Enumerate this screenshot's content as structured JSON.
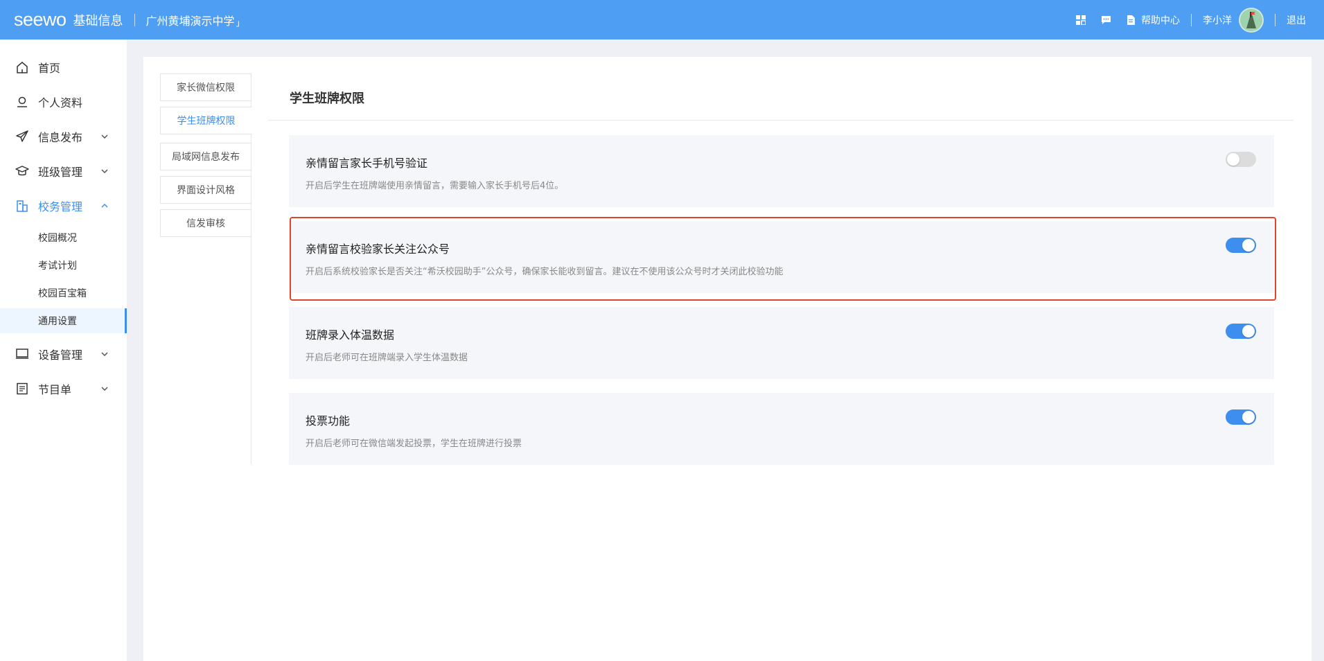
{
  "header": {
    "logo": "seewo",
    "app_title": "基础信息",
    "school": "广州黄埔演示中学",
    "school_mark": "」",
    "help_label": "帮助中心",
    "username": "李小洋",
    "logout_label": "退出",
    "icons": [
      "grid-icon",
      "message-icon",
      "document-icon"
    ]
  },
  "sidebar": {
    "items": [
      {
        "label": "首页",
        "icon": "home-icon"
      },
      {
        "label": "个人资料",
        "icon": "user-icon"
      },
      {
        "label": "信息发布",
        "icon": "send-icon"
      },
      {
        "label": "班级管理",
        "icon": "graduation-cap-icon"
      },
      {
        "label": "校务管理",
        "icon": "school-building-icon"
      },
      {
        "label": "设备管理",
        "icon": "laptop-icon"
      },
      {
        "label": "节目单",
        "icon": "list-doc-icon"
      }
    ],
    "sub_items": [
      "校园概况",
      "考试计划",
      "校园百宝箱",
      "通用设置"
    ],
    "selected_sub": "通用设置"
  },
  "tabs": [
    "家长微信权限",
    "学生班牌权限",
    "局域网信息发布",
    "界面设计风格",
    "信发审核"
  ],
  "active_tab": "学生班牌权限",
  "main": {
    "title": "学生班牌权限",
    "settings": [
      {
        "name": "亲情留言家长手机号验证",
        "desc": "开启后学生在班牌端使用亲情留言，需要输入家长手机号后4位。",
        "enabled": false
      },
      {
        "name": "亲情留言校验家长关注公众号",
        "desc": "开启后系统校验家长是否关注“希沃校园助手”公众号，确保家长能收到留言。建议在不使用该公众号时才关闭此校验功能",
        "enabled": true
      },
      {
        "name": "班牌录入体温数据",
        "desc": "开启后老师可在班牌端录入学生体温数据",
        "enabled": true
      },
      {
        "name": "投票功能",
        "desc": "开启后老师可在微信端发起投票，学生在班牌进行投票",
        "enabled": true
      }
    ]
  },
  "colors": {
    "header_bg": "#4e9ef4",
    "accent": "#3e8ef0",
    "highlight": "#e0442a"
  }
}
